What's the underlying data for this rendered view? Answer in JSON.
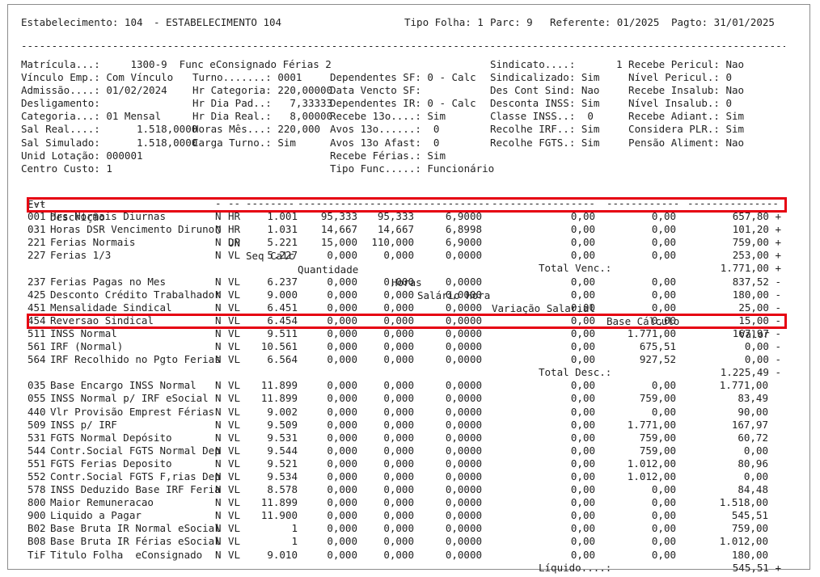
{
  "header": {
    "estab_label": "Estabelecimento: 104",
    "estab_name": "- ESTABELECIMENTO 104",
    "tipo_folha": "Tipo Folha: 1",
    "parc": "Parc: 9",
    "referente": "Referente: 01/2025",
    "pagto": "Pagto: 31/01/2025"
  },
  "separator_top": "------------------------------------------------------------------------------------------------------------------------------",
  "info": {
    "col1": [
      "Matrícula...:     1300-9  Func eConsignado Férias 2",
      "Vínculo Emp.: Com Vínculo",
      "Admissão....: 01/02/2024",
      "Desligamento:",
      "Categoria...: 01 Mensal",
      "Sal Real....:      1.518,0000",
      "Sal Simulado:      1.518,0000",
      "Unid Lotação: 000001",
      "Centro Custo: 1"
    ],
    "col2": [
      "",
      "Turno.......: 0001",
      "Hr Categoria: 220,00000",
      "Hr Dia Pad..:   7,33333",
      "Hr Dia Real.:   8,00000",
      "Horas Mês...: 220,000",
      "Carga Turno.: Sim",
      "",
      ""
    ],
    "col3": [
      "",
      "Dependentes SF: 0 - Calc",
      "Data Vencto SF:",
      "Dependentes IR: 0 - Calc",
      "Recebe 13o....: Sim",
      "Avos 13o......:  0",
      "Avos 13o Afast:  0",
      "Recebe Férias.: Sim",
      "Tipo Func.....: Funcionário"
    ],
    "col4": [
      "Sindicato....:",
      "Sindicalizado: Sim",
      "Des Cont Sind: Nao",
      "Desconta INSS: Sim",
      "Classe INSS..:  0",
      "Recolhe IRF..: Sim",
      "Recolhe FGTS.: Sim",
      "",
      ""
    ],
    "col5": [
      "1 Recebe Pericul: Nao",
      "  Nível Pericul.: 0",
      "  Recebe Insalub: Nao",
      "  Nível Insalub.: 0",
      "  Recebe Adiant.: Sim",
      "  Considera PLR.: Sim",
      "  Pensão Aliment: Nao",
      "",
      ""
    ]
  },
  "columns": {
    "evt": "Evt",
    "descricao": "Descrição",
    "o": "O",
    "un": "UN",
    "seq_calc": "Seq Calc",
    "quantidade": "Quantidade",
    "horas": "Horas",
    "salario_hora": "Salário Hora",
    "variacao": "Variação Salarial",
    "base_calculo": "Base Cálculo",
    "valor": "Valor"
  },
  "dashes": {
    "evt": "---",
    "descricao": "-------------------------",
    "o": "-",
    "un": "--",
    "seq": "--------",
    "qtd": "----------",
    "horas": "----------",
    "sal": "------------",
    "var": "-----------------",
    "base": "------------",
    "valor": "---------------"
  },
  "rows": [
    {
      "evt": "001",
      "desc": "Hrs Normais Diurnas",
      "o": "N",
      "un": "HR",
      "seq": "1.001",
      "qtd": "95,333",
      "horas": "95,333",
      "sal": "6,9000",
      "var": "0,00",
      "base": "0,00",
      "valor": "657,80 +"
    },
    {
      "evt": "031",
      "desc": "Horas DSR Vencimento Diruno",
      "o": "N",
      "un": "HR",
      "seq": "1.031",
      "qtd": "14,667",
      "horas": "14,667",
      "sal": "6,8998",
      "var": "0,00",
      "base": "0,00",
      "valor": "101,20 +"
    },
    {
      "evt": "221",
      "desc": "Ferias Normais",
      "o": "N",
      "un": "DP",
      "seq": "5.221",
      "qtd": "15,000",
      "horas": "110,000",
      "sal": "6,9000",
      "var": "0,00",
      "base": "0,00",
      "valor": "759,00 +"
    },
    {
      "evt": "227",
      "desc": "Ferias 1/3",
      "o": "N",
      "un": "VL",
      "seq": "5.227",
      "qtd": "0,000",
      "horas": "0,000",
      "sal": "0,0000",
      "var": "0,00",
      "base": "0,00",
      "valor": "253,00 +"
    },
    {
      "total": true,
      "label": "Total Venc.:",
      "valor": "1.771,00 +"
    },
    {
      "evt": "237",
      "desc": "Ferias Pagas no Mes",
      "o": "N",
      "un": "VL",
      "seq": "6.237",
      "qtd": "0,000",
      "horas": "0,000",
      "sal": "0,0000",
      "var": "0,00",
      "base": "0,00",
      "valor": "837,52 -"
    },
    {
      "evt": "425",
      "desc": "Desconto Crédito Trabalhador",
      "o": "N",
      "un": "VL",
      "seq": "9.000",
      "qtd": "0,000",
      "horas": "0,000",
      "sal": "0,0000",
      "var": "0,00",
      "base": "0,00",
      "valor": "180,00 -"
    },
    {
      "evt": "451",
      "desc": "Mensalidade Sindical",
      "o": "N",
      "un": "VL",
      "seq": "6.451",
      "qtd": "0,000",
      "horas": "0,000",
      "sal": "0,0000",
      "var": "0,00",
      "base": "0,00",
      "valor": "25,00 -"
    },
    {
      "evt": "454",
      "desc": "Reversao Sindical",
      "o": "N",
      "un": "VL",
      "seq": "6.454",
      "qtd": "0,000",
      "horas": "0,000",
      "sal": "0,0000",
      "var": "0,00",
      "base": "0,00",
      "valor": "15,00 -"
    },
    {
      "evt": "511",
      "desc": "INSS Normal",
      "o": "N",
      "un": "VL",
      "seq": "9.511",
      "qtd": "0,000",
      "horas": "0,000",
      "sal": "0,0000",
      "var": "0,00",
      "base": "1.771,00",
      "valor": "167,97 -"
    },
    {
      "evt": "561",
      "desc": "IRF (Normal)",
      "o": "N",
      "un": "VL",
      "seq": "10.561",
      "qtd": "0,000",
      "horas": "0,000",
      "sal": "0,0000",
      "var": "0,00",
      "base": "675,51",
      "valor": "0,00 -"
    },
    {
      "evt": "564",
      "desc": "IRF Recolhido no Pgto Ferias",
      "o": "N",
      "un": "VL",
      "seq": "6.564",
      "qtd": "0,000",
      "horas": "0,000",
      "sal": "0,0000",
      "var": "0,00",
      "base": "927,52",
      "valor": "0,00 -"
    },
    {
      "total": true,
      "label": "Total Desc.:",
      "valor": "1.225,49 -"
    },
    {
      "evt": "035",
      "desc": "Base Encargo INSS Normal",
      "o": "N",
      "un": "VL",
      "seq": "11.899",
      "qtd": "0,000",
      "horas": "0,000",
      "sal": "0,0000",
      "var": "0,00",
      "base": "0,00",
      "valor": "1.771,00"
    },
    {
      "evt": "055",
      "desc": "INSS Normal p/ IRF eSocial",
      "o": "N",
      "un": "VL",
      "seq": "11.899",
      "qtd": "0,000",
      "horas": "0,000",
      "sal": "0,0000",
      "var": "0,00",
      "base": "759,00",
      "valor": "83,49"
    },
    {
      "evt": "440",
      "desc": "Vlr Provisão Emprest Férias",
      "o": "N",
      "un": "VL",
      "seq": "9.002",
      "qtd": "0,000",
      "horas": "0,000",
      "sal": "0,0000",
      "var": "0,00",
      "base": "0,00",
      "valor": "90,00"
    },
    {
      "evt": "509",
      "desc": "INSS p/ IRF",
      "o": "N",
      "un": "VL",
      "seq": "9.509",
      "qtd": "0,000",
      "horas": "0,000",
      "sal": "0,0000",
      "var": "0,00",
      "base": "1.771,00",
      "valor": "167,97"
    },
    {
      "evt": "531",
      "desc": "FGTS Normal Depósito",
      "o": "N",
      "un": "VL",
      "seq": "9.531",
      "qtd": "0,000",
      "horas": "0,000",
      "sal": "0,0000",
      "var": "0,00",
      "base": "759,00",
      "valor": "60,72"
    },
    {
      "evt": "544",
      "desc": "Contr.Social FGTS Normal Dep",
      "o": "N",
      "un": "VL",
      "seq": "9.544",
      "qtd": "0,000",
      "horas": "0,000",
      "sal": "0,0000",
      "var": "0,00",
      "base": "759,00",
      "valor": "0,00"
    },
    {
      "evt": "551",
      "desc": "FGTS Ferias Deposito",
      "o": "N",
      "un": "VL",
      "seq": "9.521",
      "qtd": "0,000",
      "horas": "0,000",
      "sal": "0,0000",
      "var": "0,00",
      "base": "1.012,00",
      "valor": "80,96"
    },
    {
      "evt": "552",
      "desc": "Contr.Social FGTS F,rias Dep",
      "o": "N",
      "un": "VL",
      "seq": "9.534",
      "qtd": "0,000",
      "horas": "0,000",
      "sal": "0,0000",
      "var": "0,00",
      "base": "1.012,00",
      "valor": "0,00"
    },
    {
      "evt": "578",
      "desc": "INSS Deduzido Base IRF Feria",
      "o": "N",
      "un": "VL",
      "seq": "8.578",
      "qtd": "0,000",
      "horas": "0,000",
      "sal": "0,0000",
      "var": "0,00",
      "base": "0,00",
      "valor": "84,48"
    },
    {
      "evt": "800",
      "desc": "Maior Remuneracao",
      "o": "N",
      "un": "VL",
      "seq": "11.899",
      "qtd": "0,000",
      "horas": "0,000",
      "sal": "0,0000",
      "var": "0,00",
      "base": "0,00",
      "valor": "1.518,00"
    },
    {
      "evt": "900",
      "desc": "Liquido a Pagar",
      "o": "N",
      "un": "VL",
      "seq": "11.900",
      "qtd": "0,000",
      "horas": "0,000",
      "sal": "0,0000",
      "var": "0,00",
      "base": "0,00",
      "valor": "545,51"
    },
    {
      "evt": "B02",
      "desc": "Base Bruta IR Normal eSocial",
      "o": "N",
      "un": "VL",
      "seq": "1",
      "qtd": "0,000",
      "horas": "0,000",
      "sal": "0,0000",
      "var": "0,00",
      "base": "0,00",
      "valor": "759,00"
    },
    {
      "evt": "B08",
      "desc": "Base Bruta IR Férias eSocial",
      "o": "N",
      "un": "VL",
      "seq": "1",
      "qtd": "0,000",
      "horas": "0,000",
      "sal": "0,0000",
      "var": "0,00",
      "base": "0,00",
      "valor": "1.012,00"
    },
    {
      "evt": "TiF",
      "desc": "Titulo Folha  eConsignado",
      "o": "N",
      "un": "VL",
      "seq": "9.010",
      "qtd": "0,000",
      "horas": "0,000",
      "sal": "0,0000",
      "var": "0,00",
      "base": "0,00",
      "valor": "180,00"
    },
    {
      "total": true,
      "label": "Líquido....:",
      "valor": "545,51 +"
    }
  ],
  "highlight_color": "#e60012"
}
